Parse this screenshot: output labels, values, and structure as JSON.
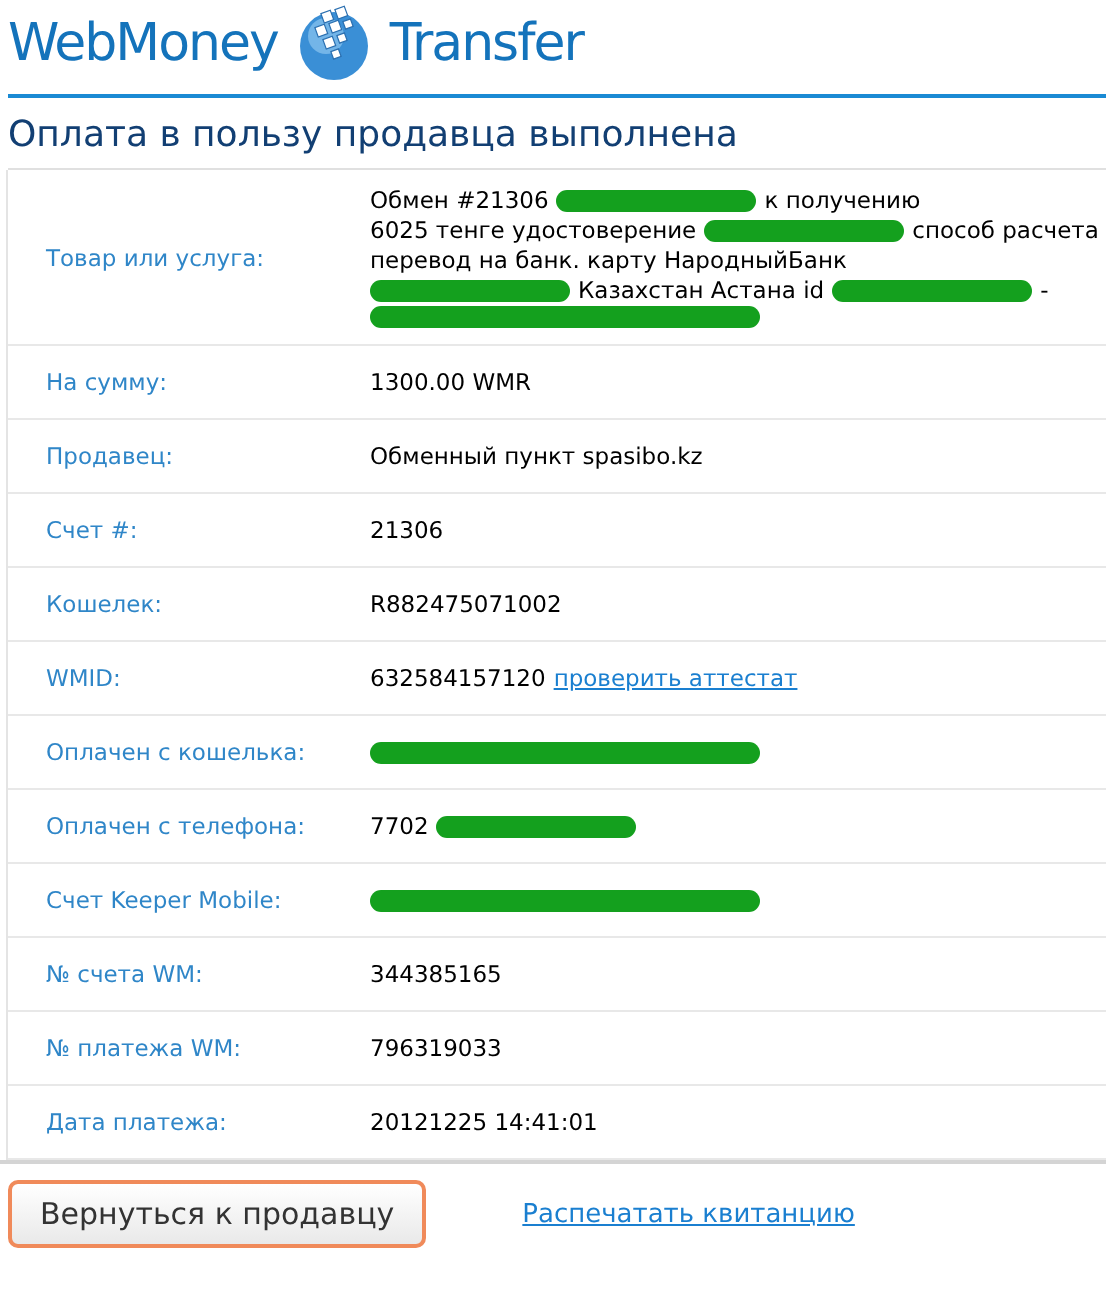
{
  "header": {
    "brand": "WebMoney",
    "product": "Transfer"
  },
  "title": "Оплата в пользу продавца выполнена",
  "rows": [
    {
      "label": "Товар или услуга:",
      "lines": [
        [
          {
            "kind": "text",
            "text": "Обмен #21306"
          },
          {
            "kind": "redacted"
          },
          {
            "kind": "text",
            "text": "к получению"
          }
        ],
        [
          {
            "kind": "text",
            "text": "6025 тенге удостоверение"
          },
          {
            "kind": "redacted"
          },
          {
            "kind": "text",
            "text": "способ расчета"
          }
        ],
        [
          {
            "kind": "text",
            "text": "перевод на банк. карту НародныйБанк"
          }
        ],
        [
          {
            "kind": "redacted"
          },
          {
            "kind": "text",
            "text": "Казахстан Астана id"
          },
          {
            "kind": "redacted"
          },
          {
            "kind": "text",
            "text": "-"
          }
        ],
        [
          {
            "kind": "redacted"
          }
        ]
      ]
    },
    {
      "label": "На сумму:",
      "lines": [
        [
          {
            "kind": "text",
            "text": "1300.00 WMR"
          }
        ]
      ]
    },
    {
      "label": "Продавец:",
      "lines": [
        [
          {
            "kind": "text",
            "text": "Обменный пункт spasibo.kz"
          }
        ]
      ]
    },
    {
      "label": "Счет #:",
      "lines": [
        [
          {
            "kind": "text",
            "text": "21306"
          }
        ]
      ]
    },
    {
      "label": "Кошелек:",
      "lines": [
        [
          {
            "kind": "text",
            "text": "R882475071002"
          }
        ]
      ]
    },
    {
      "label": "WMID:",
      "lines": [
        [
          {
            "kind": "text",
            "text": "632584157120"
          },
          {
            "kind": "link",
            "text": "проверить аттестат"
          }
        ]
      ]
    },
    {
      "label": "Оплачен с кошелька:",
      "lines": [
        [
          {
            "kind": "redacted"
          }
        ]
      ]
    },
    {
      "label": "Оплачен с телефона:",
      "lines": [
        [
          {
            "kind": "text",
            "text": "7702"
          },
          {
            "kind": "redacted"
          }
        ]
      ]
    },
    {
      "label": "Счет Keeper Mobile:",
      "lines": [
        [
          {
            "kind": "redacted"
          }
        ]
      ]
    },
    {
      "label": "№ счета WM:",
      "lines": [
        [
          {
            "kind": "text",
            "text": "344385165"
          }
        ]
      ]
    },
    {
      "label": "№ платежа WM:",
      "lines": [
        [
          {
            "kind": "text",
            "text": "796319033"
          }
        ]
      ]
    },
    {
      "label": "Дата платежа:",
      "lines": [
        [
          {
            "kind": "text",
            "text": "20121225 14:41:01"
          }
        ]
      ]
    }
  ],
  "back_button": "Вернуться к продавцу",
  "print_link": "Распечатать квитанцию"
}
